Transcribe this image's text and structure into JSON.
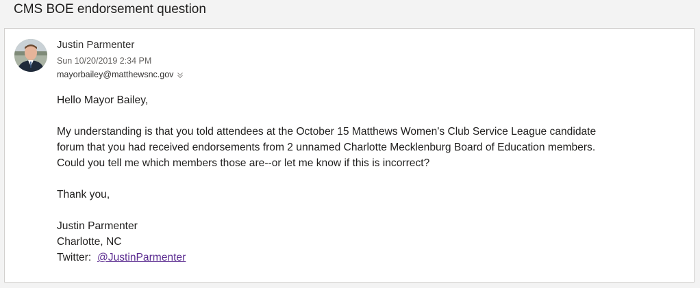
{
  "subject": "CMS BOE endorsement question",
  "message": {
    "sender_name": "Justin Parmenter",
    "timestamp": "Sun 10/20/2019 2:34 PM",
    "recipient": "mayorbailey@matthewsnc.gov",
    "expand_icon": "chevron-double-down-icon",
    "greeting": "Hello Mayor Bailey,",
    "paragraph_lines": [
      "My understanding is that you told attendees at the October 15 Matthews Women's Club Service League candidate",
      "forum that you had received endorsements from 2 unnamed Charlotte Mecklenburg Board of Education members.",
      "Could you tell me which members those are--or let me know if this is incorrect?"
    ],
    "closing": "Thank you,",
    "signature": {
      "name": "Justin Parmenter",
      "location": "Charlotte, NC",
      "twitter_label": "Twitter:",
      "twitter_handle": "@JustinParmenter"
    }
  },
  "colors": {
    "background": "#f3f3f3",
    "card": "#ffffff",
    "link": "#5c2d91"
  }
}
